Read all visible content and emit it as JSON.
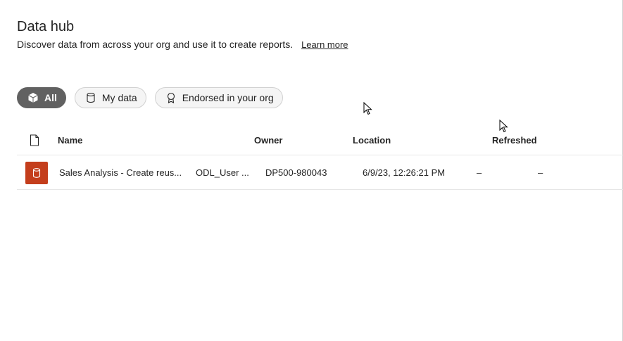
{
  "header": {
    "title": "Data hub",
    "subtitle": "Discover data from across your org and use it to create reports.",
    "learn_more": "Learn more"
  },
  "filters": [
    {
      "label": "All",
      "icon": "cube-icon",
      "active": true
    },
    {
      "label": "My data",
      "icon": "database-icon",
      "active": false
    },
    {
      "label": "Endorsed in your org",
      "icon": "ribbon-icon",
      "active": false
    }
  ],
  "table": {
    "columns": {
      "type_icon": "document-icon",
      "name": "Name",
      "owner": "Owner",
      "location": "Location",
      "refreshed": "Refreshed"
    },
    "rows": [
      {
        "icon": "dataset-icon",
        "name": "Sales Analysis - Create reus...",
        "type_text": "ODL_User ...",
        "owner": "DP500-980043",
        "refreshed": "6/9/23, 12:26:21 PM",
        "col5": "–",
        "col6": "–"
      }
    ]
  },
  "colors": {
    "active_chip": "#616161",
    "dataset_icon_bg": "#c43e1c"
  }
}
